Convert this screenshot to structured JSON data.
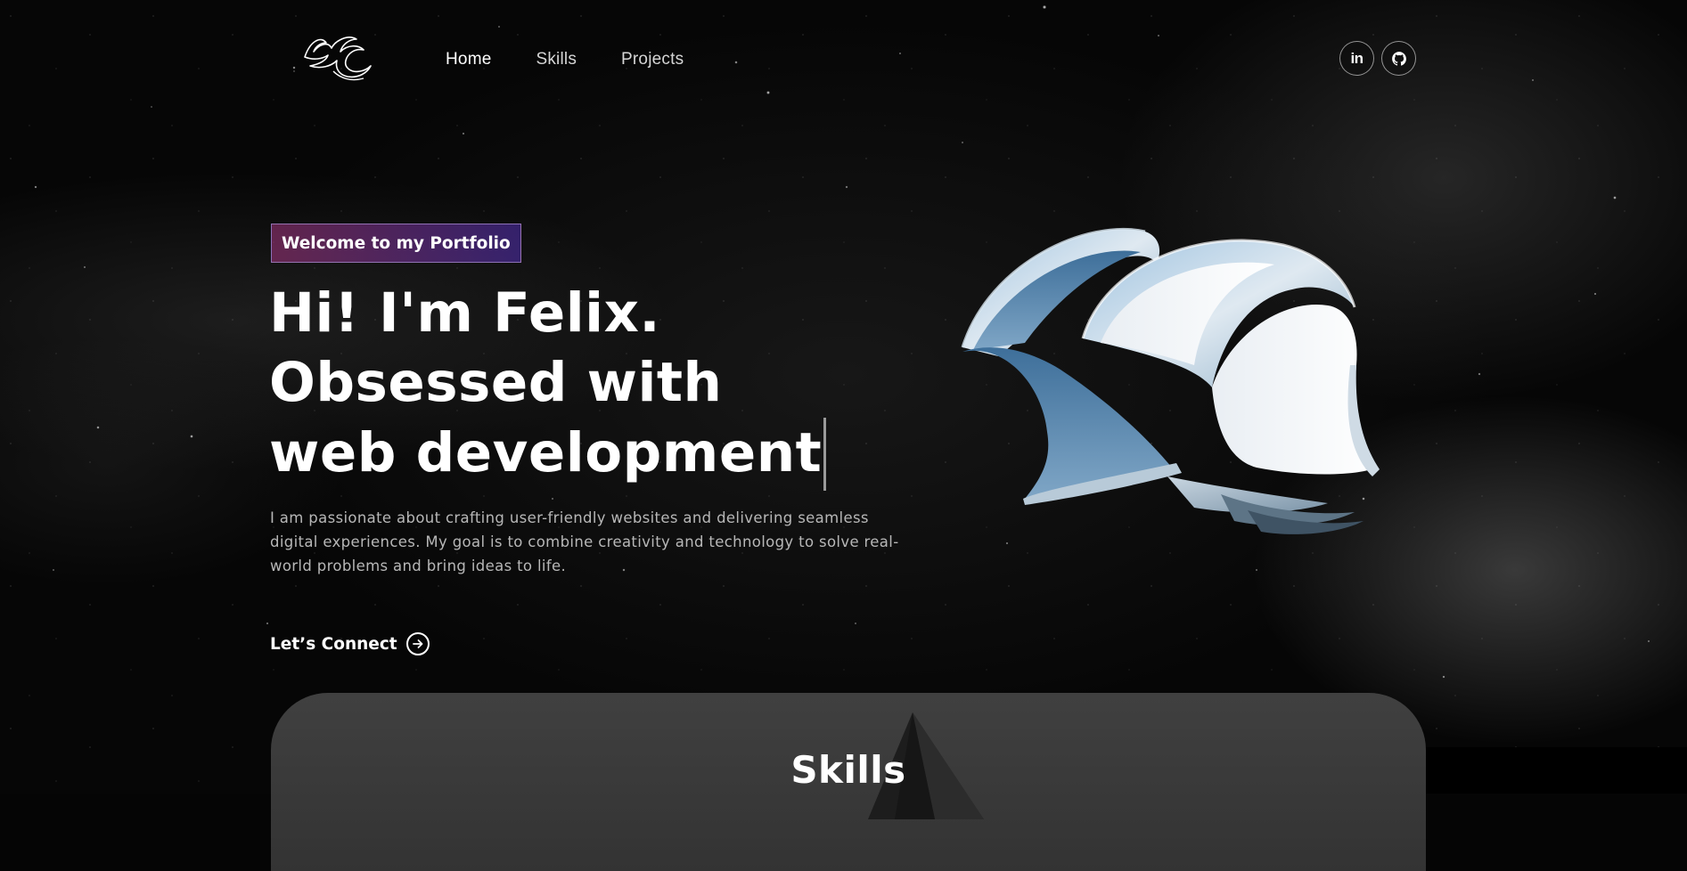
{
  "nav": {
    "links": [
      {
        "label": "Home",
        "active": true
      },
      {
        "label": "Skills",
        "active": false
      },
      {
        "label": "Projects",
        "active": false
      }
    ],
    "social": [
      {
        "icon": "linkedin-icon",
        "label": "in"
      },
      {
        "icon": "github-icon"
      }
    ]
  },
  "hero": {
    "badge": "Welcome to my Portfolio",
    "headline": [
      "Hi! I'm Felix.",
      "Obsessed with",
      "web development"
    ],
    "intro": "I am passionate about crafting user-friendly websites and delivering seamless digital experiences. My goal is to combine creativity and technology to solve real-world problems and bring ideas to life.",
    "cta": "Let’s Connect",
    "cta_icon": "arrow-right-circle-icon"
  },
  "skills": {
    "title": "Skills"
  },
  "colors": {
    "background": "#060606",
    "badge_gradient_start": "#AA367C",
    "badge_gradient_end": "#4A2FBD",
    "text_primary": "#ffffff",
    "text_muted": "#b7b7b7",
    "skills_card": "#3a3a3a"
  }
}
